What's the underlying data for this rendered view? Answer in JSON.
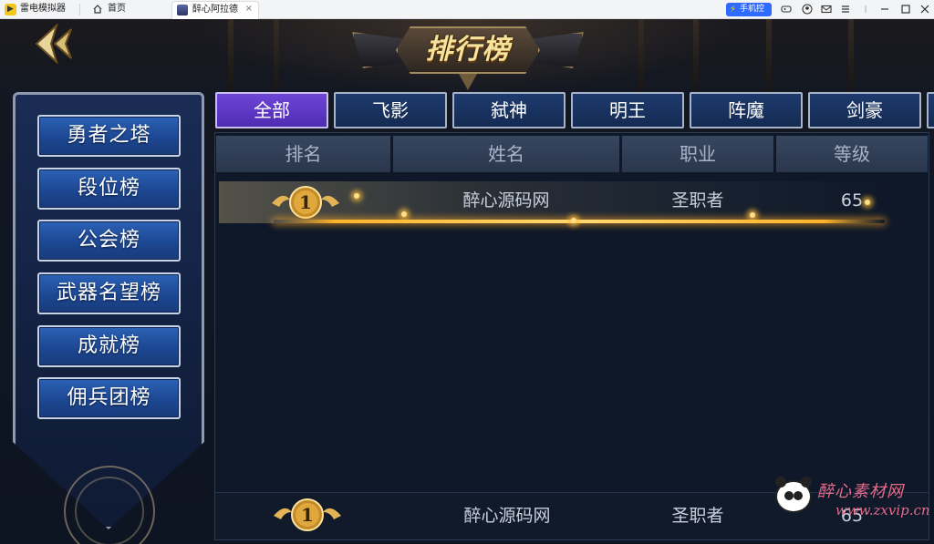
{
  "titlebar": {
    "app_name": "雷电模拟器",
    "home_tab": "首页",
    "game_tab": "醉心阿拉德",
    "phone_control": "手机控制"
  },
  "banner": {
    "title": "排行榜"
  },
  "sidebar": {
    "items": [
      {
        "label": "勇者之塔"
      },
      {
        "label": "段位榜"
      },
      {
        "label": "公会榜"
      },
      {
        "label": "武器名望榜"
      },
      {
        "label": "成就榜"
      },
      {
        "label": "佣兵团榜"
      }
    ]
  },
  "tabs": [
    {
      "label": "全部",
      "active": true
    },
    {
      "label": "飞影",
      "active": false
    },
    {
      "label": "弑神",
      "active": false
    },
    {
      "label": "明王",
      "active": false
    },
    {
      "label": "阵魔",
      "active": false
    },
    {
      "label": "剑豪",
      "active": false
    }
  ],
  "table": {
    "headers": {
      "rank": "排名",
      "name": "姓名",
      "job": "职业",
      "level": "等级"
    },
    "rows": [
      {
        "rank": "1",
        "name": "醉心源码网",
        "job": "圣职者",
        "level": "65"
      }
    ]
  },
  "my_rank": {
    "rank": "1",
    "name": "醉心源码网",
    "job": "圣职者",
    "level": "65"
  },
  "watermark": {
    "line1": "醉心素材网",
    "line2": "www.zxvip.cn"
  },
  "colors": {
    "active_tab": "#5a35c4",
    "side_button": "#1d4792",
    "gold": "#ffb32a"
  }
}
